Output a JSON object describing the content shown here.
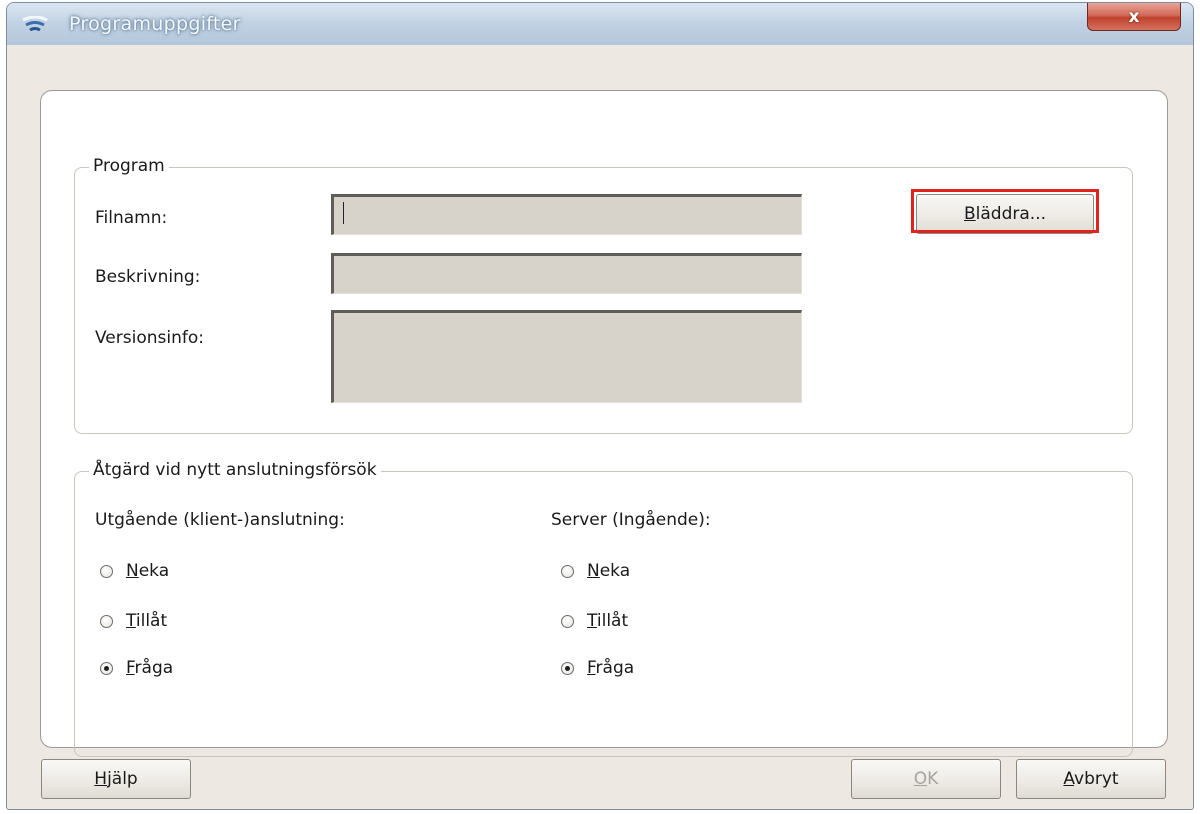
{
  "window": {
    "title": "Programuppgifter",
    "close_glyph": "x",
    "icon": "firewall-app-icon"
  },
  "program_group": {
    "legend": "Program",
    "filename_label": "Filnamn:",
    "filename_value": "",
    "description_label": "Beskrivning:",
    "description_value": "",
    "version_label": "Versionsinfo:",
    "version_value": "",
    "browse_mnemonic": "B",
    "browse_rest": "läddra..."
  },
  "action_group": {
    "legend": "Åtgärd vid nytt anslutningsförsök",
    "outgoing": {
      "heading": "Utgående (klient-)anslutning:",
      "selected": "Fråga",
      "options": [
        {
          "mnemonic": "N",
          "rest": "eka",
          "label": "Neka",
          "checked": false
        },
        {
          "mnemonic": "T",
          "rest": "illåt",
          "label": "Tillåt",
          "checked": false
        },
        {
          "mnemonic": "F",
          "rest": "råga",
          "label": "Fråga",
          "checked": true
        }
      ]
    },
    "incoming": {
      "heading": "Server (Ingående):",
      "selected": "Fråga",
      "options": [
        {
          "mnemonic": "N",
          "rest": "eka",
          "label": "Neka",
          "checked": false
        },
        {
          "mnemonic": "T",
          "rest": "illåt",
          "label": "Tillåt",
          "checked": false
        },
        {
          "mnemonic": "F",
          "rest": "råga",
          "label": "Fråga",
          "checked": true
        }
      ]
    }
  },
  "footer": {
    "help_mnemonic": "H",
    "help_rest": "jälp",
    "ok_mnemonic": "O",
    "ok_rest": "K",
    "ok_enabled": false,
    "cancel_mnemonic": "A",
    "cancel_rest": "vbryt"
  },
  "colors": {
    "highlight_border": "#e1231f",
    "field_background": "#d8d3ca",
    "dialog_background": "#ede9e2"
  }
}
